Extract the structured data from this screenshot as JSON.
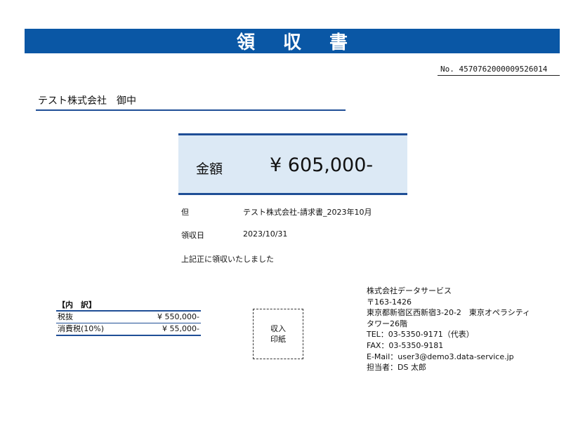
{
  "document": {
    "title": "領収書",
    "receipt_number": "No. 4570762000009526014",
    "recipient": {
      "name": "テスト株式会社",
      "honorific": "御中"
    },
    "amount": {
      "label": "金額",
      "value": "¥ 605,000-"
    },
    "details": {
      "purpose_label": "但",
      "purpose_value": "テスト株式会社-請求書_2023年10月",
      "date_label": "領収日",
      "date_value": "2023/10/31",
      "confirmation": "上記正に領収いたしました"
    },
    "breakdown": {
      "header": "【内　訳】",
      "rows": [
        {
          "label": "税抜",
          "value": "¥ 550,000-"
        },
        {
          "label": "消費税(10%)",
          "value": "¥ 55,000-"
        }
      ]
    },
    "stamp": {
      "line1": "収入",
      "line2": "印紙"
    },
    "issuer": {
      "company": "株式会社データサービス",
      "postal_code": "〒163-1426",
      "address_line1": "東京都新宿区西新宿3-20-2　東京オペラシティ",
      "address_line2": "タワー26階",
      "tel": "TEL：03-5350-9171（代表）",
      "fax": "FAX：03-5350-9181",
      "email": "E-Mail：user3@demo3.data-service.jp",
      "contact": "担当者：DS 太郎"
    }
  },
  "colors": {
    "title_bar": "#0a57a5",
    "accent_line": "#1f4e96",
    "amount_box_bg": "#dce9f5"
  }
}
